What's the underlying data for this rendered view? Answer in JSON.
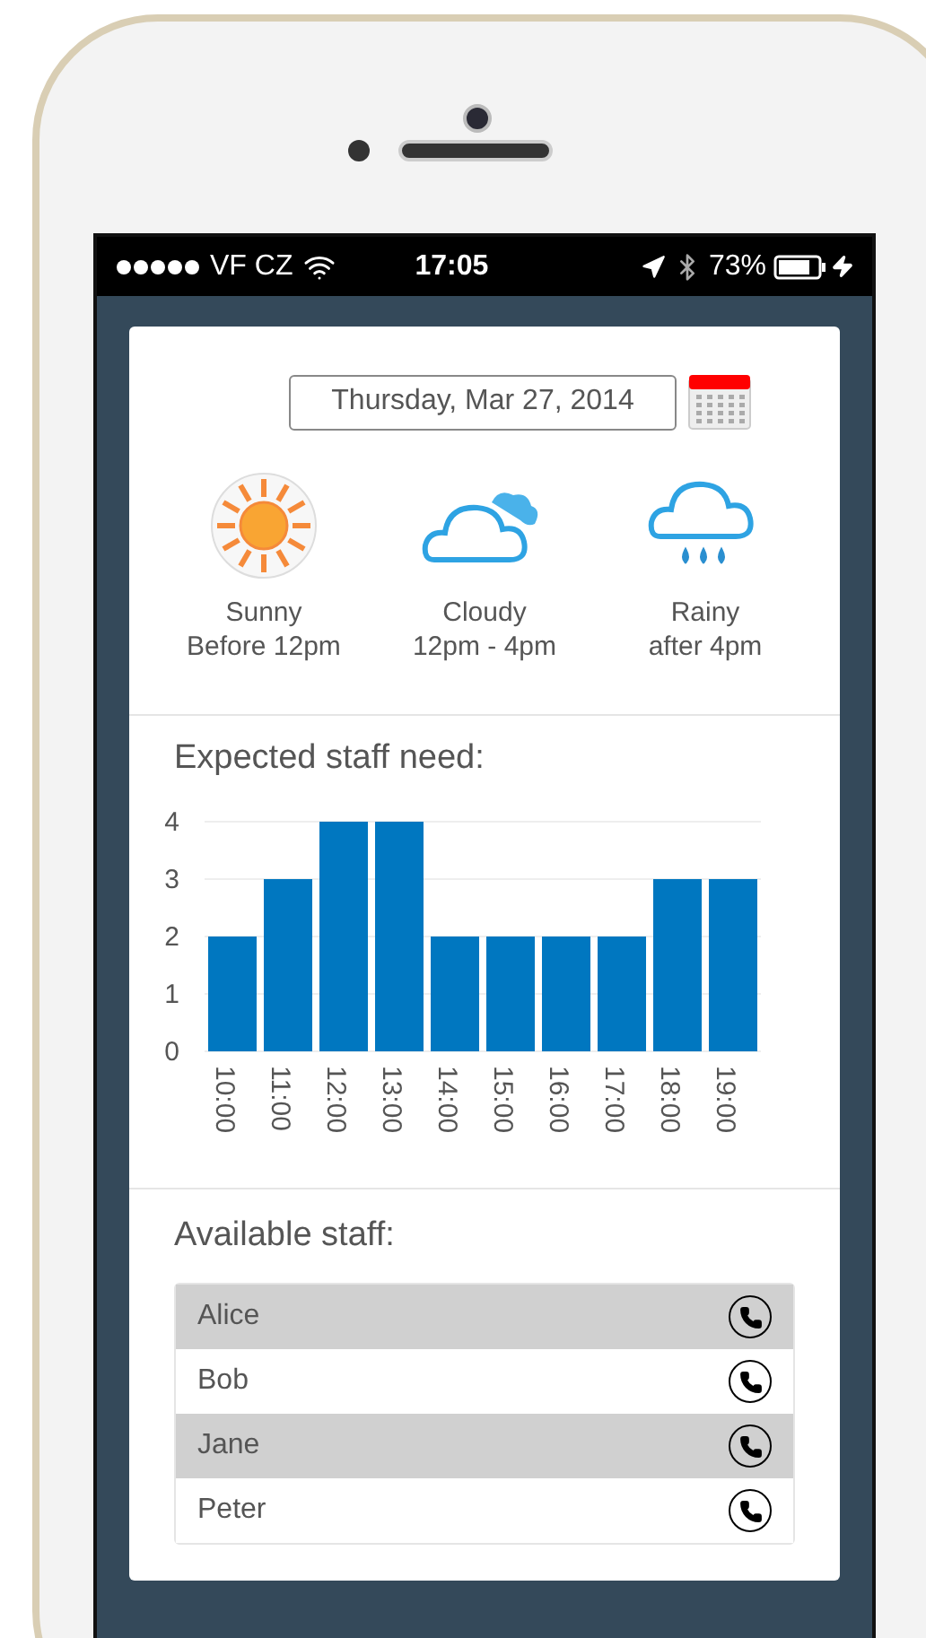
{
  "status_bar": {
    "carrier": "VF CZ",
    "time": "17:05",
    "battery": "73%"
  },
  "date_field": {
    "value": "Thursday, Mar 27, 2014"
  },
  "forecast": [
    {
      "kind": "sunny",
      "label": "Sunny",
      "period": "Before 12pm"
    },
    {
      "kind": "cloudy",
      "label": "Cloudy",
      "period": "12pm - 4pm"
    },
    {
      "kind": "rainy",
      "label": "Rainy",
      "period": "after 4pm"
    }
  ],
  "staff_need": {
    "title": "Expected staff need:",
    "chart_data": {
      "type": "bar",
      "categories": [
        "10:00",
        "11:00",
        "12:00",
        "13:00",
        "14:00",
        "15:00",
        "16:00",
        "17:00",
        "18:00",
        "19:00"
      ],
      "grid": true,
      "series": [
        {
          "color": "#0077c0",
          "values": [
            2,
            3,
            4,
            4,
            2,
            2,
            2,
            2,
            3,
            3
          ]
        }
      ],
      "ylim": [
        0,
        4
      ],
      "yticks": [
        0,
        1,
        2,
        3,
        4
      ]
    }
  },
  "available_staff": {
    "title": "Available staff:",
    "rows": [
      {
        "name": "Alice",
        "highlighted": true
      },
      {
        "name": "Bob",
        "highlighted": false
      },
      {
        "name": "Jane",
        "highlighted": true
      },
      {
        "name": "Peter",
        "highlighted": false
      }
    ]
  }
}
